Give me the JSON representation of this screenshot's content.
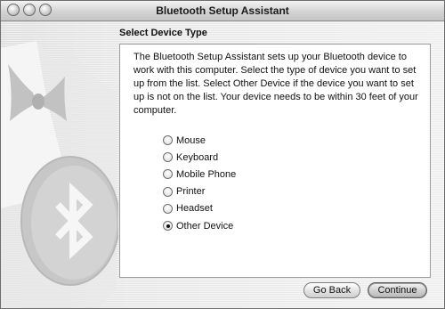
{
  "window": {
    "title": "Bluetooth Setup Assistant"
  },
  "page": {
    "section_title": "Select Device Type",
    "description": "The Bluetooth Setup Assistant sets up your Bluetooth device to work with this computer. Select the type of device you want to set up from the list. Select Other Device if the device you want to set up is not on the list. Your device needs to be within 30 feet of your computer.",
    "device_types": [
      {
        "label": "Mouse",
        "selected": false
      },
      {
        "label": "Keyboard",
        "selected": false
      },
      {
        "label": "Mobile Phone",
        "selected": false
      },
      {
        "label": "Printer",
        "selected": false
      },
      {
        "label": "Headset",
        "selected": false
      },
      {
        "label": "Other Device",
        "selected": true
      }
    ]
  },
  "buttons": {
    "back": "Go Back",
    "continue": "Continue"
  },
  "icons": {
    "window_controls": [
      "close-icon",
      "minimize-icon",
      "zoom-icon"
    ],
    "background": "tuxedo-bluetooth-icon"
  }
}
